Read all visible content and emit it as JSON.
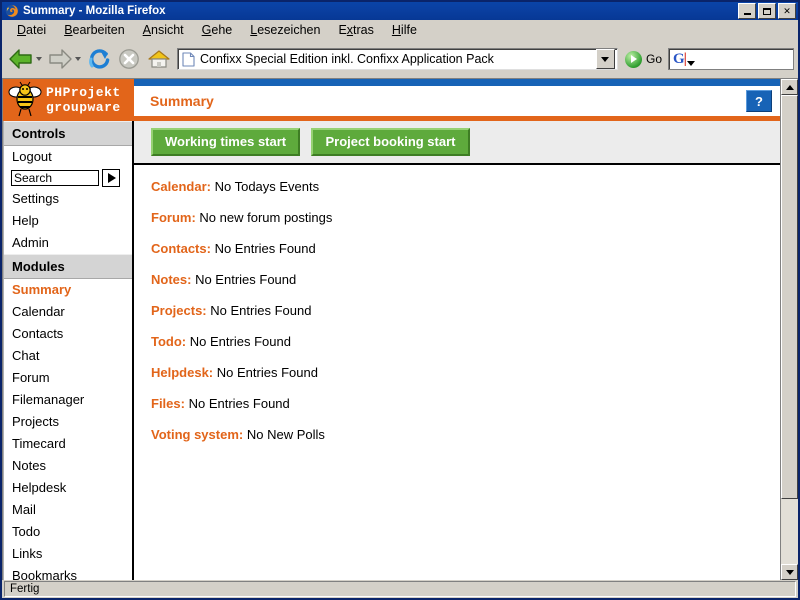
{
  "window": {
    "title": "Summary - Mozilla Firefox",
    "app_icon": "firefox-icon",
    "minimize_label": "Minimize",
    "maximize_label": "Maximize",
    "close_label": "✕"
  },
  "menubar": [
    {
      "label": "Datei",
      "accel": "D"
    },
    {
      "label": "Bearbeiten",
      "accel": "B"
    },
    {
      "label": "Ansicht",
      "accel": "A"
    },
    {
      "label": "Gehe",
      "accel": "G"
    },
    {
      "label": "Lesezeichen",
      "accel": "L"
    },
    {
      "label": "Extras",
      "accel": "x"
    },
    {
      "label": "Hilfe",
      "accel": "H"
    }
  ],
  "toolbar": {
    "back": "back-icon",
    "forward": "forward-icon",
    "reload": "reload-icon",
    "stop": "stop-icon",
    "home": "home-icon",
    "url_value": "Confixx Special Edition inkl. Confixx Application Pack",
    "url_placeholder": "",
    "go_label": "Go",
    "search_value": "",
    "search_placeholder": "",
    "google_logo": "G"
  },
  "page": {
    "logo_line1": "PHProjekt",
    "logo_line2": "groupware",
    "title": "Summary",
    "help_label": "?",
    "accent_orange": "#e2651a",
    "accent_blue": "#1763b6",
    "accent_green": "#5eaa3c"
  },
  "sidebar": {
    "controls_header": "Controls",
    "controls": [
      {
        "label": "Logout"
      },
      {
        "label": "Settings"
      },
      {
        "label": "Help"
      },
      {
        "label": "Admin"
      }
    ],
    "search_value": "Search",
    "search_placeholder": "Search",
    "search_go": "search-submit-icon",
    "modules_header": "Modules",
    "modules": [
      {
        "label": "Summary",
        "active": true
      },
      {
        "label": "Calendar",
        "active": false
      },
      {
        "label": "Contacts",
        "active": false
      },
      {
        "label": "Chat",
        "active": false
      },
      {
        "label": "Forum",
        "active": false
      },
      {
        "label": "Filemanager",
        "active": false
      },
      {
        "label": "Projects",
        "active": false
      },
      {
        "label": "Timecard",
        "active": false
      },
      {
        "label": "Notes",
        "active": false
      },
      {
        "label": "Helpdesk",
        "active": false
      },
      {
        "label": "Mail",
        "active": false
      },
      {
        "label": "Todo",
        "active": false
      },
      {
        "label": "Links",
        "active": false
      },
      {
        "label": "Bookmarks",
        "active": false
      }
    ]
  },
  "main": {
    "buttons": [
      {
        "label": "Working times start"
      },
      {
        "label": "Project booking start"
      }
    ],
    "summary_rows": [
      {
        "label": "Calendar:",
        "value": "No Todays Events"
      },
      {
        "label": "Forum:",
        "value": "No new forum postings"
      },
      {
        "label": "Contacts:",
        "value": "No Entries Found"
      },
      {
        "label": "Notes:",
        "value": "No Entries Found"
      },
      {
        "label": "Projects:",
        "value": "No Entries Found"
      },
      {
        "label": "Todo:",
        "value": "No Entries Found"
      },
      {
        "label": "Helpdesk:",
        "value": "No Entries Found"
      },
      {
        "label": "Files:",
        "value": "No Entries Found"
      },
      {
        "label": "Voting system:",
        "value": "No New Polls"
      }
    ]
  },
  "statusbar": {
    "text": "Fertig"
  }
}
